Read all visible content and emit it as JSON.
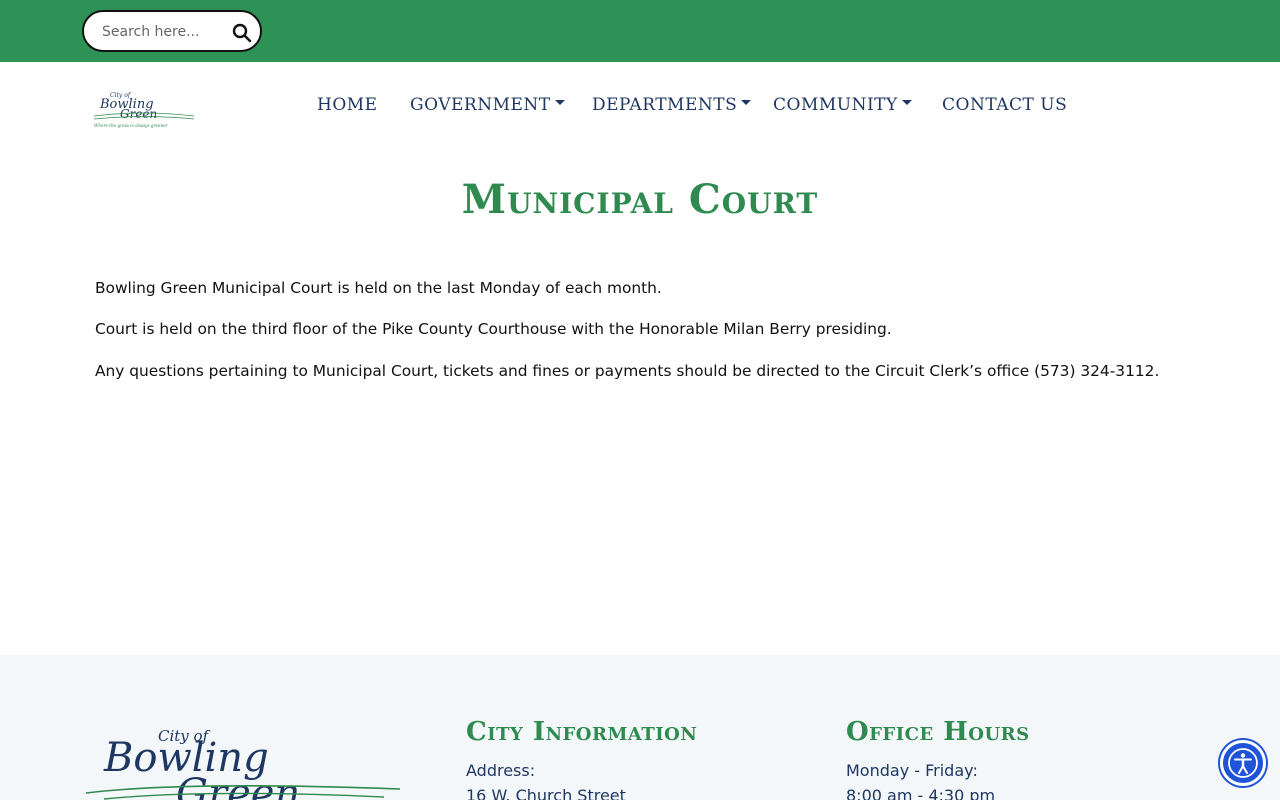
{
  "search": {
    "placeholder": "Search here..."
  },
  "nav": {
    "items": [
      {
        "label": "HOME",
        "dropdown": false
      },
      {
        "label": "GOVERNMENT",
        "dropdown": true
      },
      {
        "label": "DEPARTMENTS",
        "dropdown": true
      },
      {
        "label": "COMMUNITY",
        "dropdown": true
      },
      {
        "label": "CONTACT US",
        "dropdown": false
      }
    ]
  },
  "logo": {
    "line1": "City of",
    "line2": "Bowling",
    "line3": "Green",
    "tagline": "Where the grass is always greener"
  },
  "main": {
    "title": "Municipal Court",
    "paragraphs": [
      "Bowling Green Municipal Court is held on the last Monday of each month.",
      "Court is held on the third floor of the Pike County Courthouse with the Honorable Milan Berry presiding.",
      "Any questions pertaining to Municipal Court, tickets and fines or payments should be directed to the Circuit Clerk’s office (573) 324-3112."
    ]
  },
  "footer": {
    "city_info": {
      "heading": "City Information",
      "address_label": "Address:",
      "address_line": "16 W. Church Street"
    },
    "office_hours": {
      "heading": "Office Hours",
      "days": "Monday - Friday:",
      "hours": "8:00 am - 4:30 pm"
    }
  },
  "colors": {
    "topbar": "#2e9155",
    "nav_text": "#1e3762",
    "title_green": "#2e8a4e",
    "footer_bg": "#f4f7fa",
    "accessibility_blue": "#1f54d8"
  },
  "icons": {
    "search": "search-icon",
    "accessibility": "accessibility-icon"
  }
}
